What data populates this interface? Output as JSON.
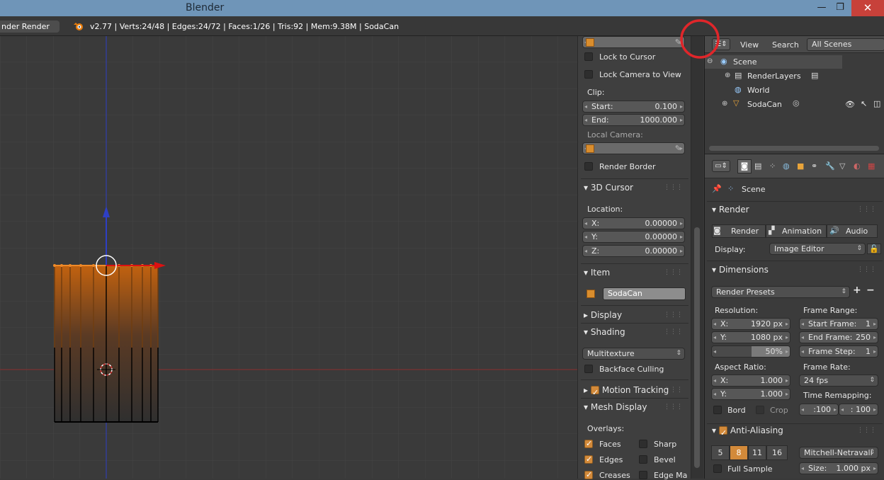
{
  "app": {
    "title": "Blender",
    "render_engine": "nder Render",
    "stats": "v2.77 | Verts:24/48 | Edges:24/72 | Faces:1/26 | Tris:92 | Mem:9.38M | SodaCan"
  },
  "window": {
    "minimize": "—",
    "maximize": "❐",
    "close": "✕"
  },
  "npanel": {
    "lock_to_cursor": "Lock to Cursor",
    "lock_camera": "Lock Camera to View",
    "clip_label": "Clip:",
    "clip_start_label": "Start:",
    "clip_start": "0.100",
    "clip_end_label": "End:",
    "clip_end": "1000.000",
    "local_camera": "Local Camera:",
    "render_border": "Render Border",
    "cursor_header": "3D Cursor",
    "location": "Location:",
    "x_label": "X:",
    "x": "0.00000",
    "y_label": "Y:",
    "y": "0.00000",
    "z_label": "Z:",
    "z": "0.00000",
    "item_header": "Item",
    "item_name": "SodaCan",
    "display_header": "Display",
    "shading_header": "Shading",
    "shading_mode": "Multitexture",
    "backface": "Backface Culling",
    "motion_tracking": "Motion Tracking",
    "mesh_display": "Mesh Display",
    "overlays": "Overlays:",
    "faces": "Faces",
    "sharp": "Sharp",
    "edges": "Edges",
    "bevel": "Bevel",
    "creases": "Creases",
    "edge_ma": "Edge Ma"
  },
  "outliner": {
    "view": "View",
    "search": "Search",
    "scenes": "All Scenes",
    "items": {
      "scene": "Scene",
      "renderlayers": "RenderLayers",
      "world": "World",
      "sodacan": "SodaCan"
    }
  },
  "props": {
    "scene": "Scene",
    "render_header": "Render",
    "render_btn": "Render",
    "animation_btn": "Animation",
    "audio_btn": "Audio",
    "display_label": "Display:",
    "display_value": "Image Editor",
    "dimensions_header": "Dimensions",
    "render_presets": "Render Presets",
    "resolution": "Resolution:",
    "res_x_label": "X:",
    "res_x": "1920 px",
    "res_y_label": "Y:",
    "res_y": "1080 px",
    "res_pct": "50%",
    "frame_range": "Frame Range:",
    "start_frame_label": "Start Frame:",
    "start_frame": "1",
    "end_frame_label": "End Frame:",
    "end_frame": "250",
    "frame_step_label": "Frame Step:",
    "frame_step": "1",
    "aspect": "Aspect Ratio:",
    "asp_x_label": "X:",
    "asp_x": "1.000",
    "asp_y_label": "Y:",
    "asp_y": "1.000",
    "frame_rate": "Frame Rate:",
    "fps": "24 fps",
    "time_remap": "Time Remapping:",
    "remap_old": ":100",
    "remap_new": ": 100",
    "bord": "Bord",
    "crop": "Crop",
    "aa_header": "Anti-Aliasing",
    "aa_5": "5",
    "aa_8": "8",
    "aa_11": "11",
    "aa_16": "16",
    "aa_filter": "Mitchell-Netravali",
    "full_sample": "Full Sample",
    "size_label": "Size:",
    "size": "1.000 px"
  },
  "colors": {
    "accent": "#d38a3a",
    "titlebar": "#6f95b8",
    "close": "#c7413a",
    "annotation": "#e0262a"
  }
}
